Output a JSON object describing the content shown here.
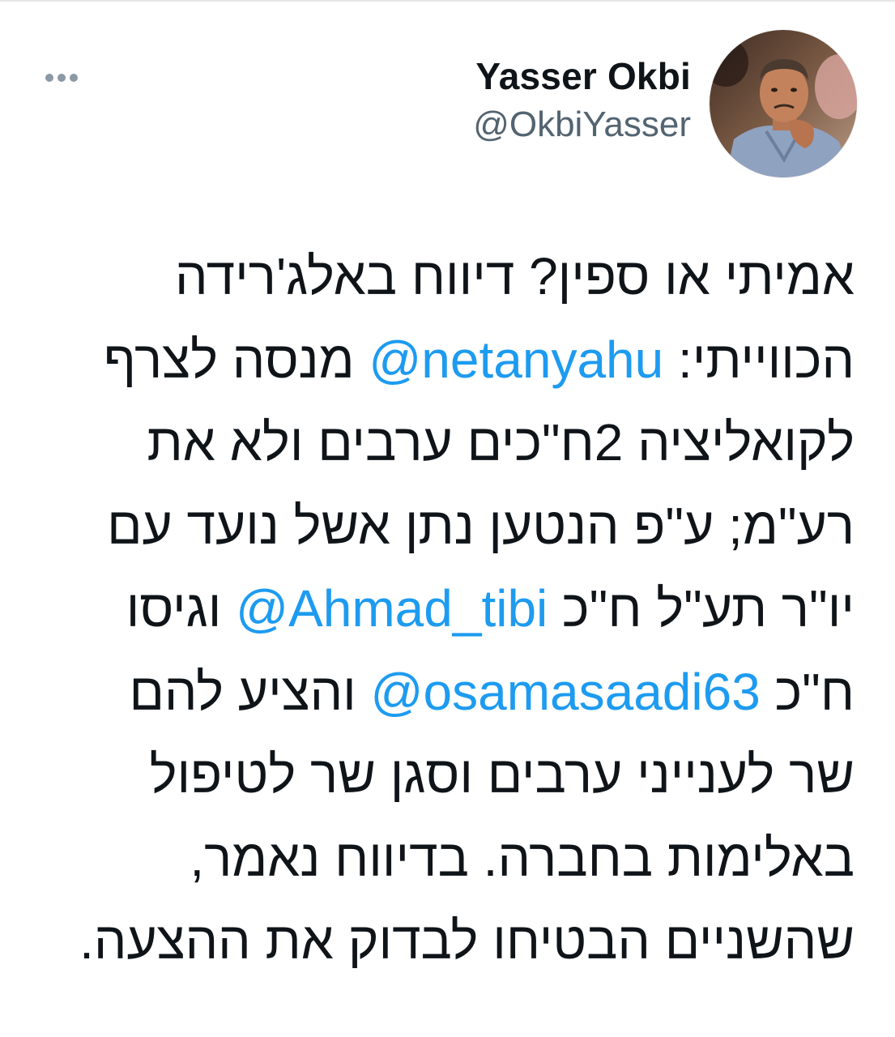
{
  "author": {
    "display_name": "Yasser Okbi",
    "handle": "@OkbiYasser"
  },
  "icons": {
    "more": "more-horizontal-icon",
    "avatar": "profile-photo"
  },
  "colors": {
    "link": "#1d9bf0",
    "text": "#0f1419",
    "secondary": "#536471"
  },
  "tweet": {
    "lines": [
      {
        "text": "אמיתי או ספין? דיווח באלג'רידה"
      },
      {
        "before": "הכווייתי: ",
        "mention": "@netanyahu",
        "after": " מנסה לצרף"
      },
      {
        "text": "לקואליציה 2ח\"כים ערבים ולא את"
      },
      {
        "text": "רע\"מ; ע\"פ הנטען נתן אשל נועד עם"
      },
      {
        "before": "יו\"ר תע\"ל ח\"כ ",
        "mention": "@Ahmad_tibi",
        "after": " וגיסו"
      },
      {
        "before": "ח\"כ ",
        "mention": "@osamasaadi63",
        "after": " והציע להם"
      },
      {
        "text": "שר לענייני ערבים וסגן שר לטיפול"
      },
      {
        "text": "באלימות בחברה. בדיווח נאמר,"
      },
      {
        "text": "שהשניים הבטיחו לבדוק את ההצעה."
      }
    ]
  }
}
